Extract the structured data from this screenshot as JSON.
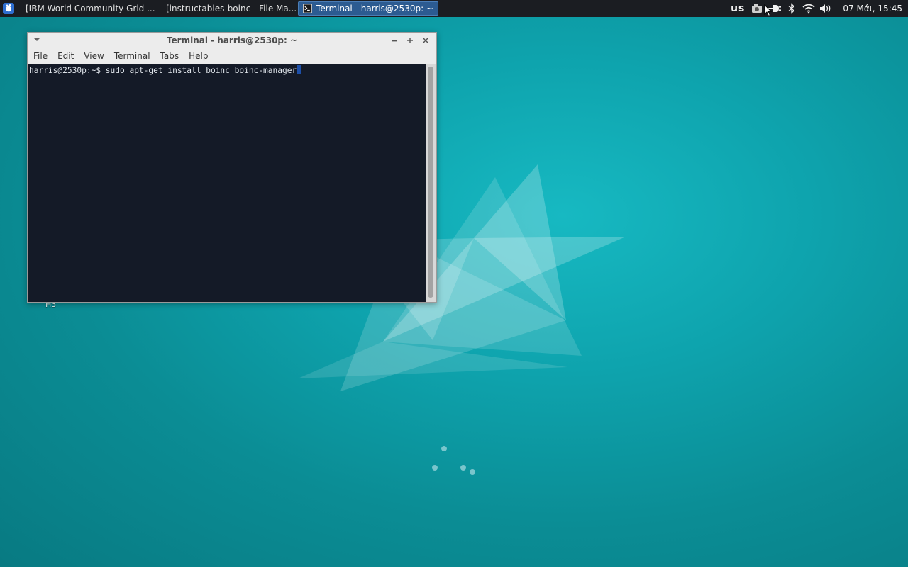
{
  "panel": {
    "tasks": [
      {
        "label": "[IBM World Community Grid ...",
        "icon": "firefox-icon"
      },
      {
        "label": "[instructables-boinc - File Ma...",
        "icon": "folder-icon"
      },
      {
        "label": "Terminal - harris@2530p: ~",
        "icon": "terminal-icon",
        "active": true
      }
    ],
    "keyboard_layout": "us",
    "clock": "07 Μάι, 15:45"
  },
  "window": {
    "title": "Terminal - harris@2530p: ~",
    "menu": [
      "File",
      "Edit",
      "View",
      "Terminal",
      "Tabs",
      "Help"
    ],
    "prompt": "harris@2530p:~$ ",
    "command": "sudo apt-get install boinc boinc-manager"
  },
  "desktop": {
    "partial_label": "H3"
  },
  "colors": {
    "panel_bg": "#1b1d22",
    "active_task": "#2c5b91",
    "terminal_bg": "#141a27",
    "cursor": "#1d4fa8",
    "desktop": "#0ea3ad"
  }
}
